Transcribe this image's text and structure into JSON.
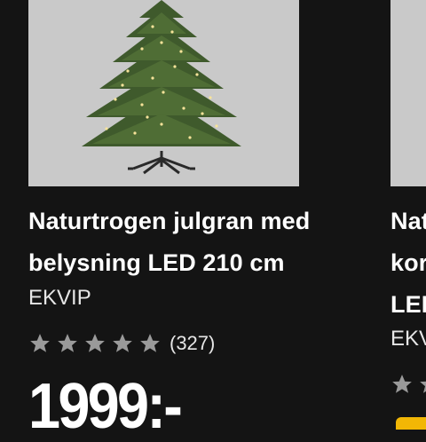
{
  "products": [
    {
      "title_line1": "Naturtrogen julgran med",
      "title_line2": "belysning LED 210 cm",
      "brand": "EKVIP",
      "rating": 5,
      "review_count": "(327)",
      "price": "1999:-"
    },
    {
      "title_line1": "Nat",
      "title_line2": "kor",
      "title_line3": "LEI",
      "brand": "EKV"
    }
  ],
  "colors": {
    "background": "#141414",
    "image_bg": "#c9c9c9",
    "star": "#9a9a9a",
    "badge": "#f2b705"
  }
}
